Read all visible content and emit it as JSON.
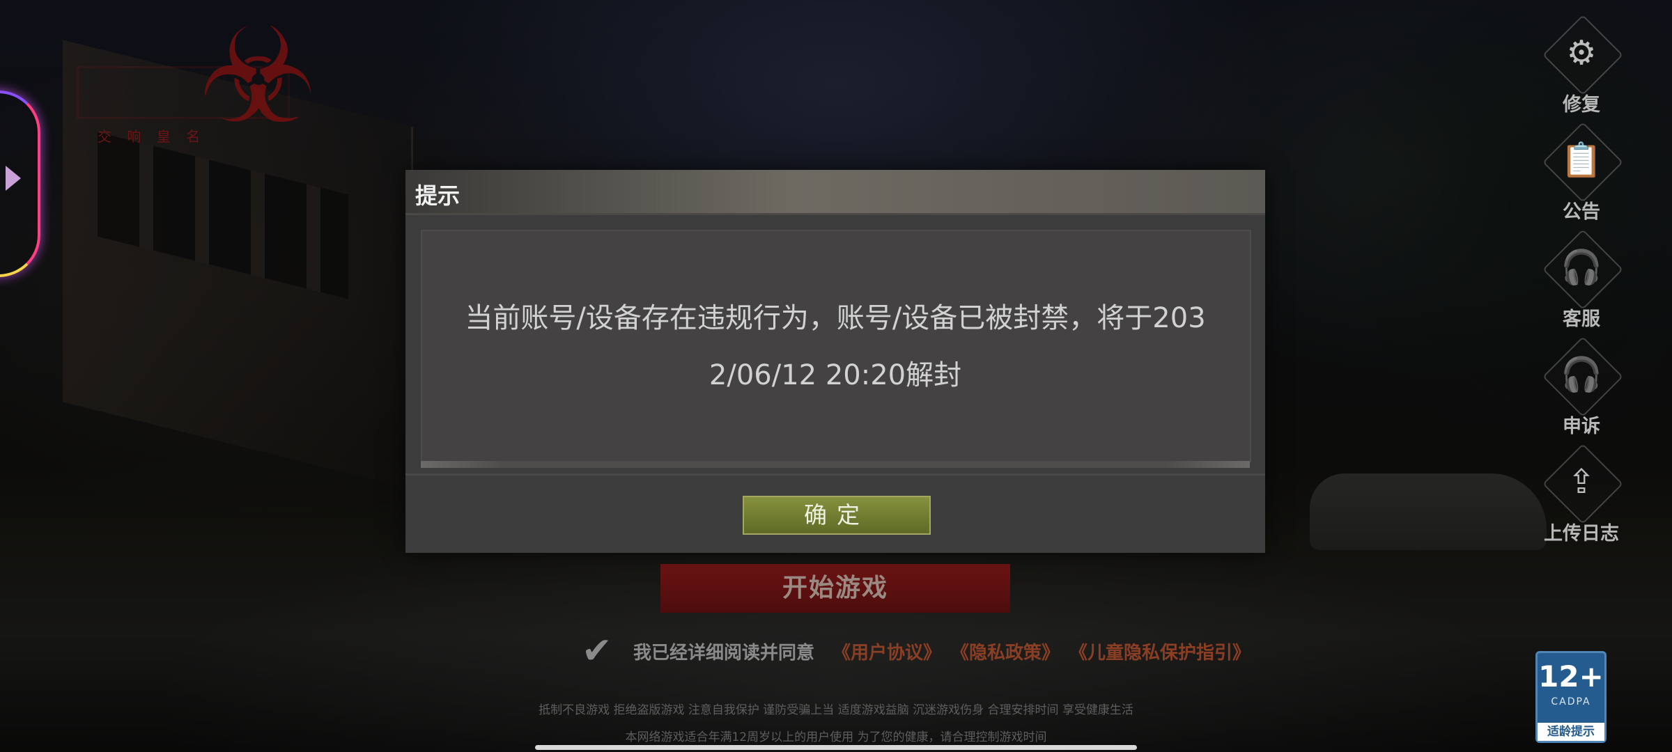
{
  "logo": {
    "mark_icon": "biohazard-icon",
    "subtitle": "交 响 皇 名"
  },
  "side_menu": [
    {
      "icon": "gear-icon",
      "glyph": "⚙",
      "label": "修复"
    },
    {
      "icon": "notice-icon",
      "glyph": "📋",
      "label": "公告"
    },
    {
      "icon": "headset-icon",
      "glyph": "🎧",
      "label": "客服"
    },
    {
      "icon": "headset-icon",
      "glyph": "🎧",
      "label": "申诉"
    },
    {
      "icon": "upload-icon",
      "glyph": "⇪",
      "label": "上传日志"
    }
  ],
  "dialog": {
    "title": "提示",
    "message_line1": "当前账号/设备存在违规行为，账号/设备已被封禁，将于203",
    "message_line2": "2/06/12 20:20解封",
    "confirm_label": "确定"
  },
  "start_button": {
    "label": "开始游戏"
  },
  "agreement": {
    "check_icon": "checkmark-icon",
    "text": "我已经详细阅读并同意",
    "links": [
      "《用户协议》",
      "《隐私政策》",
      "《儿童隐私保护指引》"
    ]
  },
  "footer": {
    "line1": "抵制不良游戏 拒绝盗版游戏 注意自我保护 谨防受骗上当 适度游戏益脑 沉迷游戏伤身 合理安排时间 享受健康生活",
    "line2": "本网络游戏适合年满12周岁以上的用户使用    为了您的健康，请合理控制游戏时间"
  },
  "age_badge": {
    "rating": "12+",
    "org": "CADPA",
    "tip": "适龄提示"
  },
  "colors": {
    "dialog_bg": "#3d3c3c",
    "confirm_button": "#86913e",
    "start_button": "#6e1414",
    "link": "#8a3f24",
    "badge": "#255c8f"
  }
}
